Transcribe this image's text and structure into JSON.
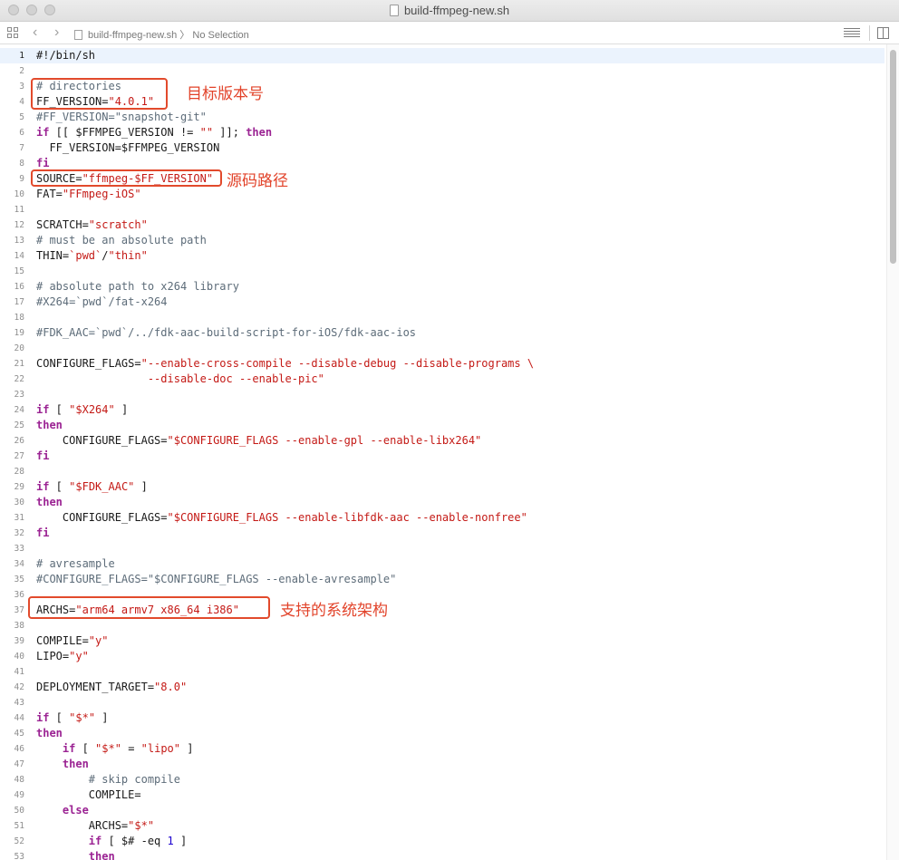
{
  "window": {
    "title": "build-ffmpeg-new.sh"
  },
  "jumpbar": {
    "file": "build-ffmpeg-new.sh",
    "selection": "No Selection"
  },
  "annotations": {
    "version": "目标版本号",
    "source": "源码路径",
    "archs": "支持的系统架构"
  },
  "colors": {
    "annotation": "#e24a2c",
    "keyword": "#9b2393",
    "string": "#c41a16",
    "comment": "#5d6c79",
    "number": "#1c00cf"
  },
  "code_lines": [
    [
      [
        "p",
        "#!/bin/sh"
      ]
    ],
    [],
    [
      [
        "c",
        "# directories"
      ]
    ],
    [
      [
        "p",
        "FF_VERSION="
      ],
      [
        "s",
        "\"4.0.1\""
      ]
    ],
    [
      [
        "c",
        "#FF_VERSION=\"snapshot-git\""
      ]
    ],
    [
      [
        "k",
        "if"
      ],
      [
        "p",
        " [[ $FFMPEG_VERSION != "
      ],
      [
        "s",
        "\"\""
      ],
      [
        "p",
        " ]]; "
      ],
      [
        "k",
        "then"
      ]
    ],
    [
      [
        "p",
        "  FF_VERSION=$FFMPEG_VERSION"
      ]
    ],
    [
      [
        "k",
        "fi"
      ]
    ],
    [
      [
        "p",
        "SOURCE="
      ],
      [
        "s",
        "\"ffmpeg-$FF_VERSION\""
      ]
    ],
    [
      [
        "p",
        "FAT="
      ],
      [
        "s",
        "\"FFmpeg-iOS\""
      ]
    ],
    [],
    [
      [
        "p",
        "SCRATCH="
      ],
      [
        "s",
        "\"scratch\""
      ]
    ],
    [
      [
        "c",
        "# must be an absolute path"
      ]
    ],
    [
      [
        "p",
        "THIN="
      ],
      [
        "s",
        "`pwd`"
      ],
      [
        "p",
        "/"
      ],
      [
        "s",
        "\"thin\""
      ]
    ],
    [],
    [
      [
        "c",
        "# absolute path to x264 library"
      ]
    ],
    [
      [
        "c",
        "#X264=`pwd`/fat-x264"
      ]
    ],
    [],
    [
      [
        "c",
        "#FDK_AAC=`pwd`/../fdk-aac-build-script-for-iOS/fdk-aac-ios"
      ]
    ],
    [],
    [
      [
        "p",
        "CONFIGURE_FLAGS="
      ],
      [
        "s",
        "\"--enable-cross-compile --disable-debug --disable-programs \\"
      ]
    ],
    [
      [
        "s",
        "                 --disable-doc --enable-pic\""
      ]
    ],
    [],
    [
      [
        "k",
        "if"
      ],
      [
        "p",
        " [ "
      ],
      [
        "s",
        "\"$X264\""
      ],
      [
        "p",
        " ]"
      ]
    ],
    [
      [
        "k",
        "then"
      ]
    ],
    [
      [
        "p",
        "    CONFIGURE_FLAGS="
      ],
      [
        "s",
        "\"$CONFIGURE_FLAGS --enable-gpl --enable-libx264\""
      ]
    ],
    [
      [
        "k",
        "fi"
      ]
    ],
    [],
    [
      [
        "k",
        "if"
      ],
      [
        "p",
        " [ "
      ],
      [
        "s",
        "\"$FDK_AAC\""
      ],
      [
        "p",
        " ]"
      ]
    ],
    [
      [
        "k",
        "then"
      ]
    ],
    [
      [
        "p",
        "    CONFIGURE_FLAGS="
      ],
      [
        "s",
        "\"$CONFIGURE_FLAGS --enable-libfdk-aac --enable-nonfree\""
      ]
    ],
    [
      [
        "k",
        "fi"
      ]
    ],
    [],
    [
      [
        "c",
        "# avresample"
      ]
    ],
    [
      [
        "c",
        "#CONFIGURE_FLAGS=\"$CONFIGURE_FLAGS --enable-avresample\""
      ]
    ],
    [],
    [
      [
        "p",
        "ARCHS="
      ],
      [
        "s",
        "\"arm64 armv7 x86_64 i386\""
      ]
    ],
    [],
    [
      [
        "p",
        "COMPILE="
      ],
      [
        "s",
        "\"y\""
      ]
    ],
    [
      [
        "p",
        "LIPO="
      ],
      [
        "s",
        "\"y\""
      ]
    ],
    [],
    [
      [
        "p",
        "DEPLOYMENT_TARGET="
      ],
      [
        "s",
        "\"8.0\""
      ]
    ],
    [],
    [
      [
        "k",
        "if"
      ],
      [
        "p",
        " [ "
      ],
      [
        "s",
        "\"$"
      ],
      [
        "sb",
        "*"
      ],
      [
        "s",
        "\""
      ],
      [
        "p",
        " ]"
      ]
    ],
    [
      [
        "k",
        "then"
      ]
    ],
    [
      [
        "p",
        "    "
      ],
      [
        "k",
        "if"
      ],
      [
        "p",
        " [ "
      ],
      [
        "s",
        "\"$"
      ],
      [
        "sb",
        "*"
      ],
      [
        "s",
        "\""
      ],
      [
        "p",
        " = "
      ],
      [
        "s",
        "\"lipo\""
      ],
      [
        "p",
        " ]"
      ]
    ],
    [
      [
        "p",
        "    "
      ],
      [
        "k",
        "then"
      ]
    ],
    [
      [
        "p",
        "        "
      ],
      [
        "c",
        "# skip compile"
      ]
    ],
    [
      [
        "p",
        "        COMPILE="
      ]
    ],
    [
      [
        "p",
        "    "
      ],
      [
        "k",
        "else"
      ]
    ],
    [
      [
        "p",
        "        ARCHS="
      ],
      [
        "s",
        "\"$"
      ],
      [
        "sb",
        "*"
      ],
      [
        "s",
        "\""
      ]
    ],
    [
      [
        "p",
        "        "
      ],
      [
        "k",
        "if"
      ],
      [
        "p",
        " [ $# -eq "
      ],
      [
        "n",
        "1"
      ],
      [
        "p",
        " ]"
      ]
    ],
    [
      [
        "p",
        "        "
      ],
      [
        "k",
        "then"
      ]
    ]
  ]
}
